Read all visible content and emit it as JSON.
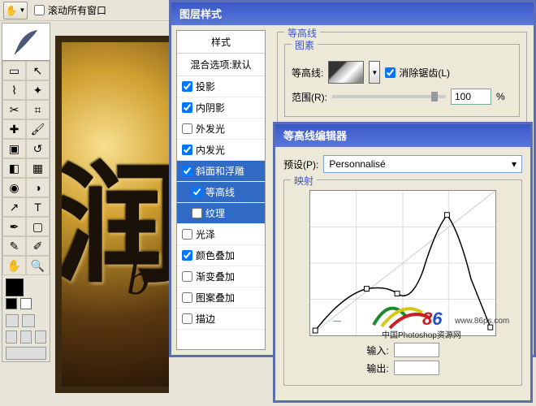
{
  "topbar": {
    "scroll_all_windows": "滚动所有窗口"
  },
  "dialog1": {
    "title": "图层样式",
    "styles_header": "样式",
    "blend_options": "混合选项:默认",
    "items": [
      {
        "label": "投影",
        "checked": true
      },
      {
        "label": "内阴影",
        "checked": true
      },
      {
        "label": "外发光",
        "checked": false
      },
      {
        "label": "内发光",
        "checked": true
      },
      {
        "label": "斜面和浮雕",
        "checked": true,
        "selected": true
      },
      {
        "label": "等高线",
        "checked": true,
        "sub": true,
        "selected": true
      },
      {
        "label": "纹理",
        "checked": false,
        "sub": true,
        "selected": true
      },
      {
        "label": "光泽",
        "checked": false
      },
      {
        "label": "颜色叠加",
        "checked": true
      },
      {
        "label": "渐变叠加",
        "checked": false
      },
      {
        "label": "图案叠加",
        "checked": false
      },
      {
        "label": "描边",
        "checked": false
      }
    ],
    "group_contour": "等高线",
    "group_elements": "图素",
    "contour_label": "等高线:",
    "antialias": "消除锯齿(L)",
    "range_label": "范围(R):",
    "range_value": "100",
    "range_unit": "%"
  },
  "dialog2": {
    "title": "等高线编辑器",
    "preset_label": "预设(P):",
    "preset_value": "Personnalisé",
    "mapping": "映射",
    "input_label": "输入:",
    "output_label": "输出:"
  },
  "canvas": {
    "glyph": "润",
    "sub": "b"
  },
  "watermark": {
    "dash": "—",
    "url": "www.86ps.com",
    "desc": "中国Photoshop资源网",
    "p8": "8",
    "p6": "6",
    "ps": "ps"
  }
}
